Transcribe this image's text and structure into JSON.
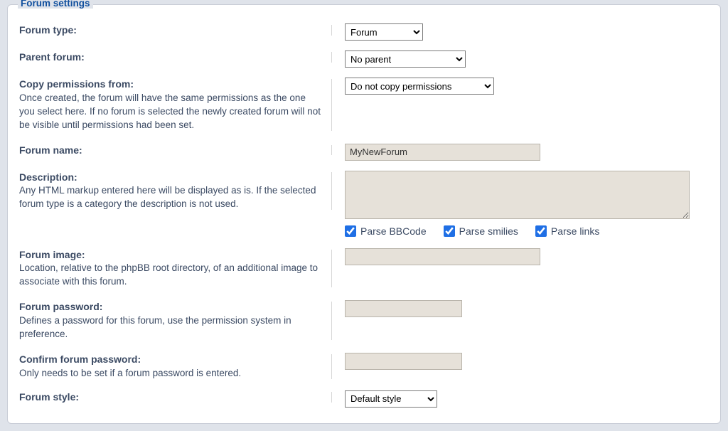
{
  "legend": "Forum settings",
  "rows": {
    "forum_type": {
      "label": "Forum type:"
    },
    "parent": {
      "label": "Parent forum:"
    },
    "copy_perms": {
      "label": "Copy permissions from:",
      "help": "Once created, the forum will have the same permissions as the one you select here. If no forum is selected the newly created forum will not be visible until permissions had been set."
    },
    "forum_name": {
      "label": "Forum name:"
    },
    "description": {
      "label": "Description:",
      "help": "Any HTML markup entered here will be displayed as is. If the selected forum type is a category the description is not used."
    },
    "forum_image": {
      "label": "Forum image:",
      "help": "Location, relative to the phpBB root directory, of an additional image to associate with this forum."
    },
    "password": {
      "label": "Forum password:",
      "help": "Defines a password for this forum, use the permission system in preference."
    },
    "password2": {
      "label": "Confirm forum password:",
      "help": "Only needs to be set if a forum password is entered."
    },
    "style": {
      "label": "Forum style:"
    }
  },
  "values": {
    "forum_type_selected": "Forum",
    "parent_selected": "No parent",
    "copy_perms_selected": "Do not copy permissions",
    "forum_name": "MyNewForum",
    "description": "",
    "forum_image": "",
    "password": "",
    "password2": "",
    "style_selected": "Default style"
  },
  "checkboxes": {
    "bbcode": {
      "label": "Parse BBCode",
      "checked": true
    },
    "smilies": {
      "label": "Parse smilies",
      "checked": true
    },
    "links": {
      "label": "Parse links",
      "checked": true
    }
  }
}
